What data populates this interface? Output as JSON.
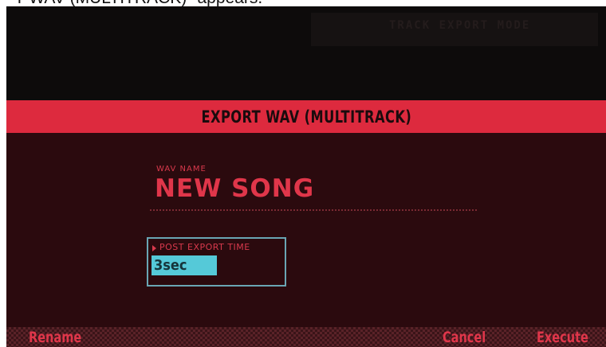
{
  "caption": "T WAV (MULTITRACK)\" appears.",
  "background": {
    "faint_text": "TRACK EXPORT MODE"
  },
  "dialog": {
    "title": "EXPORT WAV (MULTITRACK)",
    "wav_name": {
      "label": "WAV NAME",
      "value": "NEW SONG"
    },
    "post_export_time": {
      "label": "POST EXPORT TIME",
      "value": "3sec"
    }
  },
  "function_bar": {
    "rename": "Rename",
    "cancel": "Cancel",
    "execute": "Execute"
  },
  "colors": {
    "accent_red": "#dd2a3e",
    "panel": "#2b0a0e",
    "highlight_cyan": "#55c9d8"
  }
}
